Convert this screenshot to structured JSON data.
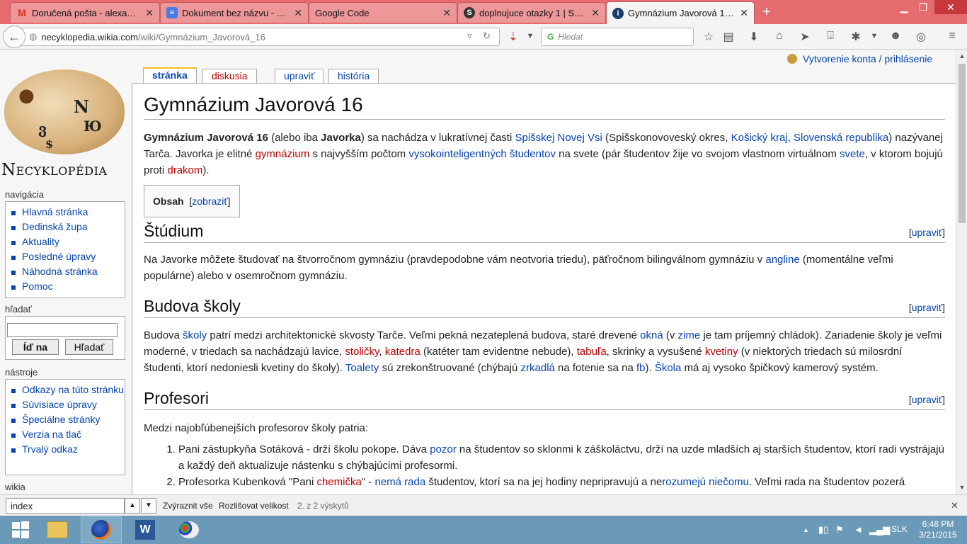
{
  "browser": {
    "tabs": [
      {
        "title": "Doručená pošta - alexande...",
        "icon": "gmail-icon",
        "active": false
      },
      {
        "title": "Dokument bez názvu - Dok...",
        "icon": "docs-icon",
        "active": false
      },
      {
        "title": "Google Code",
        "icon": "",
        "active": false
      },
      {
        "title": "doplnujuce otazky 1 | Scho...",
        "icon": "scholar-icon",
        "active": false
      },
      {
        "title": "Gymnázium Javorová 16 - ...",
        "icon": "wikia-icon",
        "active": true
      }
    ],
    "url_domain": "necyklopedia.wikia.com",
    "url_path": "/wiki/Gymnázium_Javorová_16",
    "search_placeholder": "Hledat"
  },
  "personal": {
    "login": "Vytvorenie konta / prihlásenie"
  },
  "logo": {
    "text": "Necyklopédia"
  },
  "sidebar": {
    "nav_heading": "navigácia",
    "nav_items": [
      "Hlavná stránka",
      "Dedinská župa",
      "Aktuality",
      "Posledné úpravy",
      "Náhodná stránka",
      "Pomoc"
    ],
    "search_heading": "hľadať",
    "search_go": "Íď na",
    "search_find": "Hľadať",
    "tools_heading": "nástroje",
    "tools_items": [
      "Odkazy na túto stránku",
      "Súvisiace úpravy",
      "Špeciálne stránky",
      "Verzia na tlač",
      "Trvalý odkaz"
    ],
    "wikia_heading": "wikia"
  },
  "ctabs": {
    "page": "stránka",
    "discussion": "diskusia",
    "edit": "upraviť",
    "history": "história"
  },
  "article": {
    "title": "Gymnázium Javorová 16",
    "intro": {
      "t1": "Gymnázium Javorová 16",
      "t2": " (alebo iba ",
      "t3": "Javorka",
      "t4": ") sa nachádza v lukratívnej časti ",
      "l1": "Spišskej Novej Vsi",
      "t5": " (Spišskonovoveský okres, ",
      "l2": "Košický kraj",
      "t6": ", ",
      "l3": "Slovenská republika",
      "t7": ") nazývanej Tarča. Javorka je elitné ",
      "n1": "gymnázium",
      "t8": " s najvyšším počtom ",
      "l4": "vysokointeligentných študentov",
      "t9": " na svete (pár študentov žije vo svojom vlastnom virtuálnom ",
      "l5": "svete",
      "t10": ", v ktorom bojujú proti ",
      "n2": "drakom",
      "t11": ")."
    },
    "toc": {
      "title": "Obsah",
      "toggle_open": "[",
      "toggle": "zobraziť",
      "toggle_close": "]"
    },
    "edit_open": "[",
    "edit_label": "upraviť",
    "edit_close": "]",
    "s1": {
      "title": "Štúdium",
      "p1": "Na Javorke môžete študovať na štvorročnom gymnáziu (pravdepodobne vám neotvoria triedu), päťročnom bilingválnom gymnáziu v ",
      "l1": "angline",
      "p2": " (momentálne veľmi populárne) alebo v osemročnom gymnáziu."
    },
    "s2": {
      "title": "Budova školy",
      "a": "Budova ",
      "l1": "školy",
      "b": " patrí medzi architektonické skvosty Tarče. Veľmi pekná nezateplená budova, staré drevené ",
      "l2": "okná",
      "c": " (v ",
      "l3": "zime",
      "d": " je tam príjemný chládok). Zariadenie školy je veľmi moderné, v triedach sa nachádzajú lavice, ",
      "n1": "stoličky",
      "e": ", ",
      "n2": "katedra",
      "f": " (katéter tam evidentne nebude), ",
      "n3": "tabuľa",
      "g": ", skrinky a vysušené ",
      "n4": "kvetiny",
      "h": " (v niektorých triedach sú milosrdní študenti, ktorí nedoniesli kvetiny do školy). ",
      "l4": "Toalety",
      "i": " sú zrekonštruované (chýbajú ",
      "l5": "zrkadlá",
      "j": " na fotenie sa na ",
      "l6": "fb",
      "k": "). ",
      "l7": "Škola",
      "m": " má aj vysoko špičkový kamerový systém."
    },
    "s3": {
      "title": "Profesori",
      "intro": "Medzi najobľúbenejších profesorov školy patria:",
      "li1a": "Pani zástupkyňa Sotáková - drží školu pokope. Dáva ",
      "li1l": "pozor",
      "li1b": " na študentov so sklonmi k záškoláctvu, drží na uzde mladších aj starších študentov, ktorí radi vystrájajú a každý deň aktualizuje nástenku s chýbajúcimi profesormi.",
      "li2a": "Profesorka Kubenková \"Pani ",
      "li2n": "chemička",
      "li2b": "\" - ",
      "li2l1": "nemá rada",
      "li2c": " študentov, ktorí sa na jej hodiny nepripravujú a ne",
      "li2l2": "rozumejú",
      "li2d": " ",
      "li2l3": "niečomu",
      "li2e": ". Veľmi rada na študentov pozerá"
    }
  },
  "findbar": {
    "query": "index",
    "highlight": "Zvýraznit vše",
    "matchcase": "Rozlišovat velikost",
    "status": "2. z 2 výskytů"
  },
  "taskbar": {
    "lang": "SLK",
    "time": "6:48 PM",
    "date": "3/21/2015"
  },
  "colors": {
    "tabbar": "#e66b6e",
    "link": "#0645ad",
    "newlink": "#ba0000",
    "taskbar": "#6b9ab8"
  }
}
